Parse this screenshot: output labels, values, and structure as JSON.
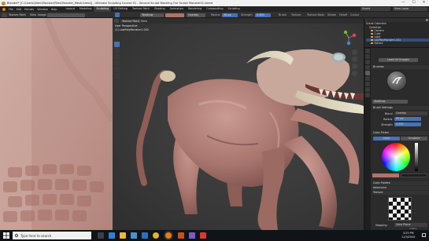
{
  "titlebar": {
    "title": "Blender* [C:\\Users\\Allen\\Monster\\Files\\Monster_Mesh.blend] - Ultimate Sculpting Course 01 - Second Sculpt Blocking Our Sculpt Monster01.blend",
    "min": "—",
    "max": "☐",
    "close": "✕"
  },
  "menubar": {
    "items": [
      "File",
      "Edit",
      "Render",
      "Window",
      "Help"
    ],
    "workspace_tabs": [
      "Layout",
      "Modeling",
      "Sculpting",
      "UV Editing",
      "Texture Paint",
      "Shading",
      "Animation",
      "Rendering",
      "Compositing",
      "Scripting"
    ],
    "active_tab": "Sculpting",
    "scene_label": "Scene",
    "viewlayer_label": "View Layer"
  },
  "left_header": {
    "mode": "Texture Paint",
    "view": "View",
    "image": "Image"
  },
  "tool_header": {
    "brush_name": "TexDraw",
    "blend_label": "Overlay",
    "radius_label": "Radius",
    "radius_value": "50 px",
    "strength_label": "Strength",
    "strength_value": "0.500",
    "brush_menu": "Brush",
    "texture_menu": "Texture",
    "texture_mask_menu": "Texture Mask",
    "stroke_menu": "Stroke",
    "falloff_menu": "Falloff",
    "cursor_menu": "Cursor"
  },
  "viewport": {
    "mode": "Texture Paint",
    "view_menus": [
      "View"
    ],
    "info_line1": "User Perspective",
    "info_line2": "(1) LowPolyMonster1.002"
  },
  "outliner": {
    "title": "Scene Collection",
    "rows": [
      {
        "label": "Collection",
        "selected": false
      },
      {
        "label": "Camera",
        "selected": false
      },
      {
        "label": "Cube",
        "selected": false
      },
      {
        "label": "Light",
        "selected": false
      },
      {
        "label": "LowPolyMonster1.002",
        "selected": true
      },
      {
        "label": "Sphere",
        "selected": false
      }
    ]
  },
  "properties": {
    "top_button": "Load UV Images",
    "brushes_section": "Brushes",
    "brush_field": "TexDraw",
    "brush_settings_section": "Brush Settings",
    "blend_label": "Blend",
    "blend_value": "Overlay",
    "radius_label": "Radius",
    "radius_value": "50 px",
    "strength_label": "Strength",
    "strength_value": "0.500",
    "color_picker_section": "Color Picker",
    "color_tab_1": "Color",
    "color_tab_2": "Gradient",
    "color_palette_section": "Color Palette",
    "advanced_section": "Advanced",
    "texture_section": "Texture",
    "bottom_field": "Mapping",
    "bottom_value": "View Plane"
  },
  "statusbar": {
    "version": "2.90.1"
  },
  "taskbar": {
    "search_placeholder": "Type here to search",
    "time": "3:25 PM",
    "date": "11/3/2020"
  },
  "colors": {
    "accent": "#4772b3",
    "brush_color": "#b07468",
    "secondary_color": "#1e1e1e",
    "skin": "#b07f76"
  }
}
